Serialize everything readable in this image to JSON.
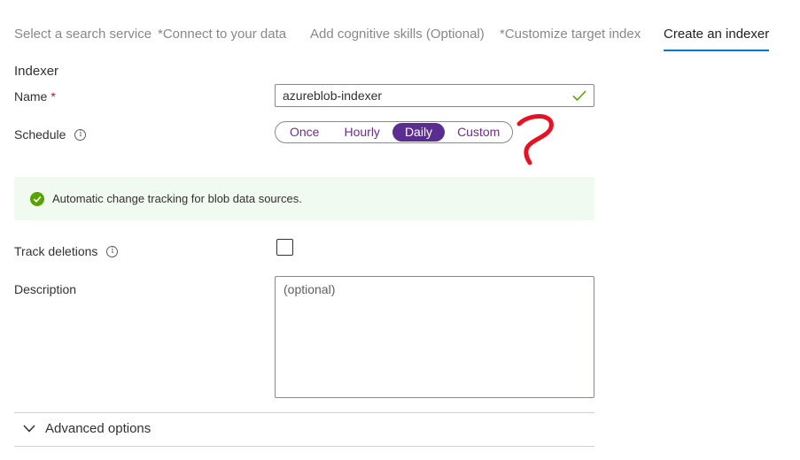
{
  "tabs": [
    {
      "label": "Select a search service"
    },
    {
      "label": "*Connect to your data"
    },
    {
      "label": "Add cognitive skills (Optional)"
    },
    {
      "label": "*Customize target index"
    },
    {
      "label": "Create an indexer"
    }
  ],
  "active_tab": "Create an indexer",
  "section_title": "Indexer",
  "name": {
    "label": "Name",
    "required_mark": "*",
    "value": "azureblob-indexer",
    "valid_icon": "check-icon"
  },
  "schedule": {
    "label": "Schedule",
    "info_glyph": "i",
    "options": [
      "Once",
      "Hourly",
      "Daily",
      "Custom"
    ],
    "selected": "Daily"
  },
  "banner": {
    "text": "Automatic change tracking for blob data sources.",
    "icon": "success-check-icon",
    "color": "#57a300"
  },
  "track_deletions": {
    "label": "Track deletions",
    "info_glyph": "i",
    "checked": false
  },
  "description": {
    "label": "Description",
    "placeholder": "(optional)"
  },
  "advanced": {
    "label": "Advanced options",
    "icon": "chevron-down-icon"
  },
  "colors": {
    "accent": "#0078d4",
    "pill": "#5c2d91",
    "annotation": "#e81123"
  }
}
